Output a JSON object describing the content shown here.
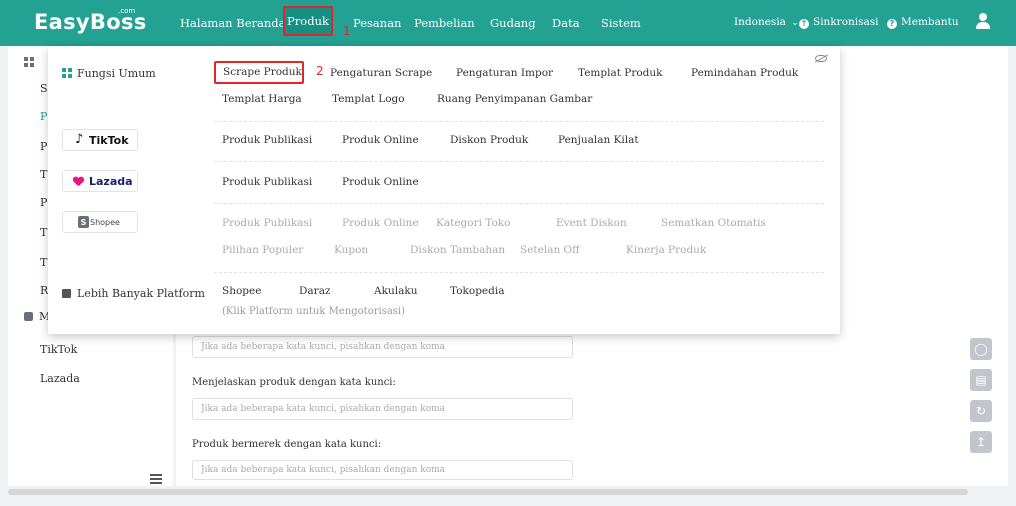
{
  "topbar": {
    "logo": "EasyBoss",
    "logo_sup": ".com",
    "nav": [
      "Halaman Beranda",
      "Produk",
      "Pesanan",
      "Pembelian",
      "Gudang",
      "Data",
      "Sistem"
    ],
    "language": "Indonesia",
    "sync": "Sinkronisasi",
    "help": "Membantu",
    "mark_1": "1"
  },
  "sidebar": {
    "partial_lines": [
      "S",
      "P",
      "P",
      "T",
      "P",
      "T",
      "T",
      "R"
    ],
    "section2": "M",
    "items": [
      "TikTok",
      "Lazada"
    ]
  },
  "main": {
    "label_1": "Menjelaskan produk dengan kata kunci:",
    "label_2": "Produk bermerek dengan kata kunci:",
    "placeholder": "Jika ada beberapa kata kunci, pisahkan dengan koma"
  },
  "dropdown": {
    "mark_2": "2",
    "general": {
      "title": "Fungsi Umum",
      "row1": [
        "Scrape Produk",
        "Pengaturan Scrape",
        "Pengaturan Impor",
        "Templat Produk",
        "Pemindahan Produk"
      ],
      "row2": [
        "Templat Harga",
        "Templat Logo",
        "Ruang Penyimpanan Gambar"
      ]
    },
    "tiktok": {
      "badge": "TikTok",
      "links": [
        "Produk Publikasi",
        "Produk Online",
        "Diskon Produk",
        "Penjualan Kilat"
      ]
    },
    "lazada": {
      "badge": "Lazada",
      "links": [
        "Produk Publikasi",
        "Produk Online"
      ]
    },
    "shopee": {
      "badge": "Shopee",
      "row1": [
        "Produk Publikasi",
        "Produk Online",
        "Kategori Toko",
        "Event Diskon",
        "Sematkan Otomatis"
      ],
      "row2": [
        "Pilihan Populer",
        "Kupon",
        "Diskon Tambahan",
        "Setelan Off",
        "Kinerja Produk"
      ]
    },
    "more": {
      "title": "Lebih Banyak Platform",
      "links": [
        "Shopee",
        "Daraz",
        "Akulaku",
        "Tokopedia"
      ],
      "hint": "(Klik Platform untuk Mengotorisasi)"
    }
  },
  "colors": {
    "brand": "#23a193",
    "highlight": "#e0252b",
    "tiktok": "#111111",
    "lazada": "#f0137f"
  }
}
